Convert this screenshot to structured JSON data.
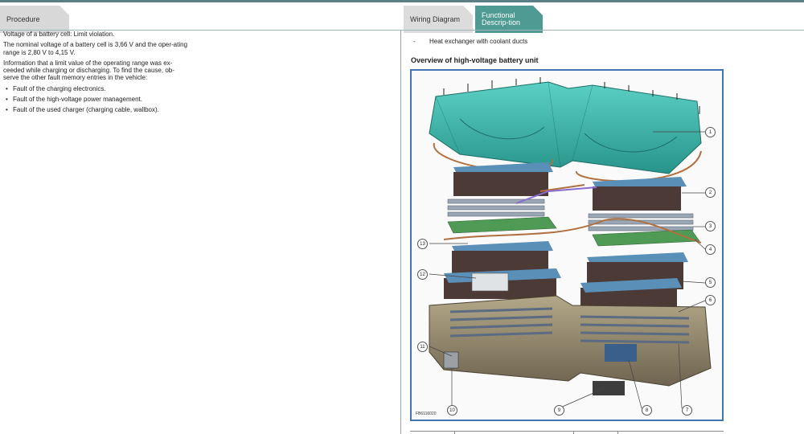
{
  "tabs": {
    "procedure": "Procedure",
    "wiring_diagram": "Wiring Diagram",
    "functional_description": "Functional Descrip-tion"
  },
  "left": {
    "paragraphs": [
      "Voltage of a battery cell: Limit violation.",
      "The nominal voltage of a battery cell is 3,66 V and the oper-ating range is 2,80 V to 4,15 V.",
      "Information that a limit value of the operating range was ex-ceeded while charging or discharging. To find the cause, ob-serve the other fault memory entries in the vehicle:"
    ],
    "bullets": [
      "Fault of the charging electronics.",
      "Fault of the high-voltage power management.",
      "Fault of the used charger (charging cable, wallbox)."
    ]
  },
  "right": {
    "list_dash": "-",
    "list_item": "Heat exchanger with coolant ducts",
    "figure_title": "Overview of high-voltage battery unit",
    "figure_id": "FB6116020",
    "callouts": [
      "1",
      "2",
      "3",
      "4",
      "5",
      "6",
      "7",
      "8",
      "9",
      "10",
      "11",
      "12",
      "13"
    ]
  },
  "colors": {
    "tab_active": "#4f9a92",
    "figure_border": "#3f74b5",
    "cover": "#39b5aa",
    "module": "#4c3a36",
    "module_top": "#5a8fb8",
    "housing": "#8f826b",
    "cooling": "#9aa6b3",
    "board": "#4f9a55"
  }
}
